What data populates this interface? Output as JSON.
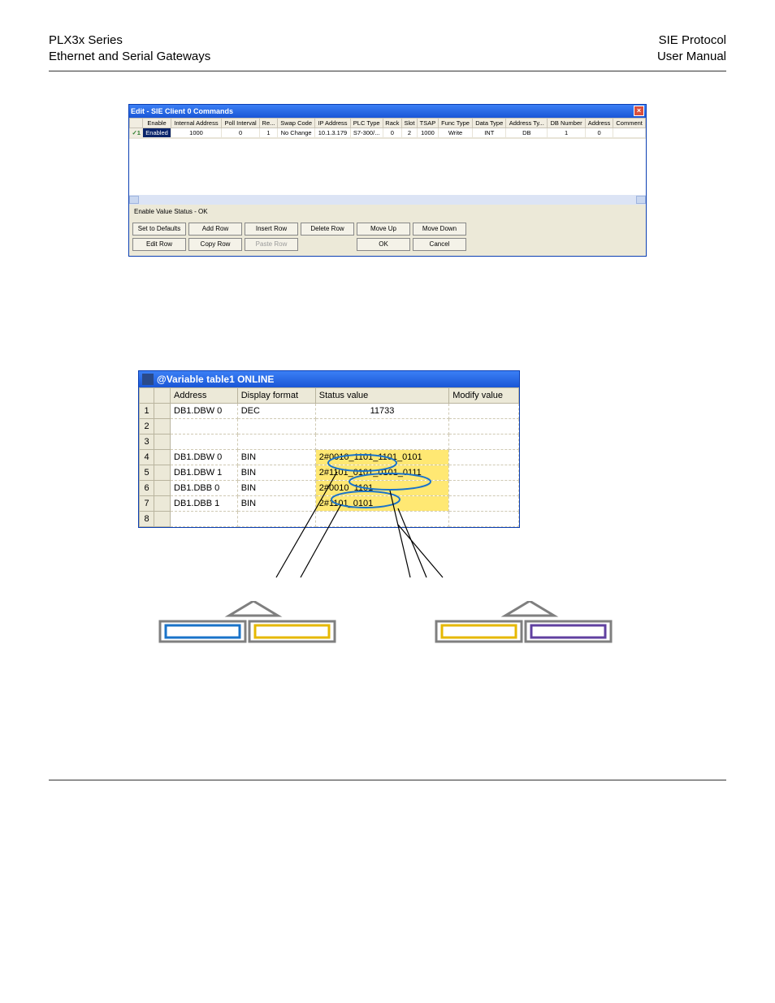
{
  "header": {
    "left1": "PLX3x Series",
    "left2": "Ethernet and Serial Gateways",
    "right1": "SIE Protocol",
    "right2": "User Manual"
  },
  "win1": {
    "title": "Edit - SIE Client 0 Commands",
    "columns": [
      "",
      "Enable",
      "Internal Address",
      "Poll Interval",
      "Re...",
      "Swap Code",
      "IP Address",
      "PLC Type",
      "Rack",
      "Slot",
      "TSAP",
      "Func Type",
      "Data Type",
      "Address Ty...",
      "DB Number",
      "Address",
      "Comment"
    ],
    "row": {
      "num": "✓1",
      "enable": "Enabled",
      "internal_address": "1000",
      "poll_interval": "0",
      "re": "1",
      "swap_code": "No Change",
      "ip_address": "10.1.3.179",
      "plc_type": "S7-300/...",
      "rack": "0",
      "slot": "2",
      "tsap": "1000",
      "func_type": "Write",
      "data_type": "INT",
      "address_ty": "DB",
      "db_number": "1",
      "address": "0",
      "comment": ""
    },
    "status": "Enable Value Status - OK",
    "buttons": {
      "set_defaults": "Set to Defaults",
      "add_row": "Add Row",
      "insert_row": "Insert Row",
      "delete_row": "Delete Row",
      "move_up": "Move Up",
      "move_down": "Move Down",
      "edit_row": "Edit Row",
      "copy_row": "Copy Row",
      "paste_row": "Paste Row",
      "ok": "OK",
      "cancel": "Cancel"
    }
  },
  "win2": {
    "title": "@Variable table1  ONLINE",
    "columns": {
      "addr": "Address",
      "disp": "Display format",
      "status": "Status value",
      "modify": "Modify value"
    },
    "rows": [
      {
        "n": "1",
        "addr": "DB1.DBW    0",
        "disp": "DEC",
        "status": "11733",
        "hl": false
      },
      {
        "n": "2",
        "addr": "",
        "disp": "",
        "status": "",
        "hl": false
      },
      {
        "n": "3",
        "addr": "",
        "disp": "",
        "status": "",
        "hl": false
      },
      {
        "n": "4",
        "addr": "DB1.DBW    0",
        "disp": "BIN",
        "status": "2#0010_1101_1101_0101",
        "hl": true
      },
      {
        "n": "5",
        "addr": "DB1.DBW    1",
        "disp": "BIN",
        "status": "2#1101_0101_0101_0111",
        "hl": true
      },
      {
        "n": "6",
        "addr": "DB1.DBB    0",
        "disp": "BIN",
        "status": "2#0010_1101",
        "hl": true
      },
      {
        "n": "7",
        "addr": "DB1.DBB    1",
        "disp": "BIN",
        "status": "2#1101_0101",
        "hl": true
      },
      {
        "n": "8",
        "addr": "",
        "disp": "",
        "status": "",
        "hl": false
      }
    ]
  }
}
